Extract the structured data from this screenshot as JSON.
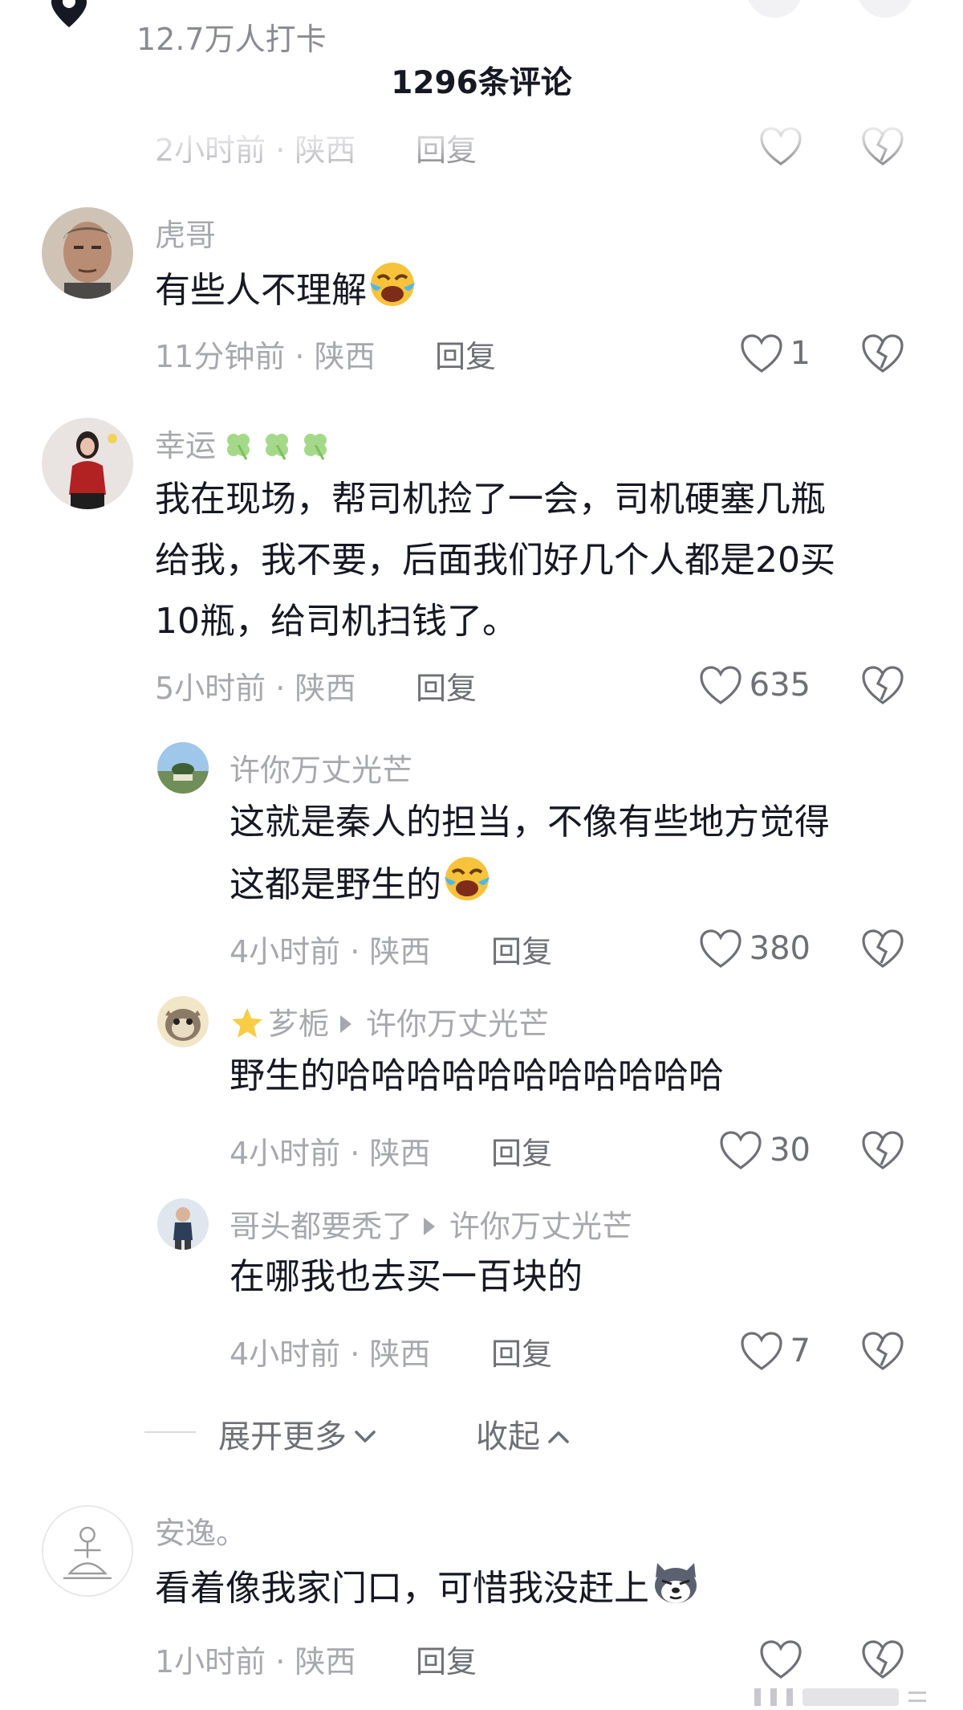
{
  "header": {
    "checkin_text": "12.7万人打卡",
    "comment_count": "1296条评论"
  },
  "partial_comment": {
    "time_location": "2小时前 · 陕西",
    "reply_label": "回复"
  },
  "comments": [
    {
      "username": "虎哥",
      "text": "有些人不理解",
      "emoji": "laughing-tears-emoji",
      "time_location": "11分钟前 · 陕西",
      "reply_label": "回复",
      "likes": "1"
    },
    {
      "username": "幸运",
      "username_decoration": "clover-icon",
      "text_lines": [
        "我在现场，帮司机捡了一会，司机硬塞几瓶",
        "给我，我不要，后面我们好几个人都是20买",
        "10瓶，给司机扫钱了。"
      ],
      "time_location": "5小时前 · 陕西",
      "reply_label": "回复",
      "likes": "635"
    },
    {
      "username": "安逸。",
      "text": "看着像我家门口，可惜我没赶上",
      "emoji": "husky-dog-emoji",
      "time_location": "1小时前 · 陕西",
      "reply_label": "回复"
    }
  ],
  "replies": [
    {
      "username": "许你万丈光芒",
      "text_lines": [
        "这就是秦人的担当，不像有些地方觉得",
        "这都是野生的"
      ],
      "emoji": "laughing-tears-emoji",
      "time_location": "4小时前 · 陕西",
      "reply_label": "回复",
      "likes": "380"
    },
    {
      "username": "芗栀",
      "username_decoration": "star-icon",
      "reply_to": "许你万丈光芒",
      "text": "野生的哈哈哈哈哈哈哈哈哈哈哈",
      "time_location": "4小时前 · 陕西",
      "reply_label": "回复",
      "likes": "30"
    },
    {
      "username": "哥头都要秃了",
      "reply_to": "许你万丈光芒",
      "text": "在哪我也去买一百块的",
      "time_location": "4小时前 · 陕西",
      "reply_label": "回复",
      "likes": "7"
    }
  ],
  "thread_controls": {
    "expand_label": "展开更多",
    "collapse_label": "收起"
  },
  "colors": {
    "secondary_text": "#a7a8ad",
    "primary_text": "#161823",
    "action_text": "#6f7076"
  }
}
